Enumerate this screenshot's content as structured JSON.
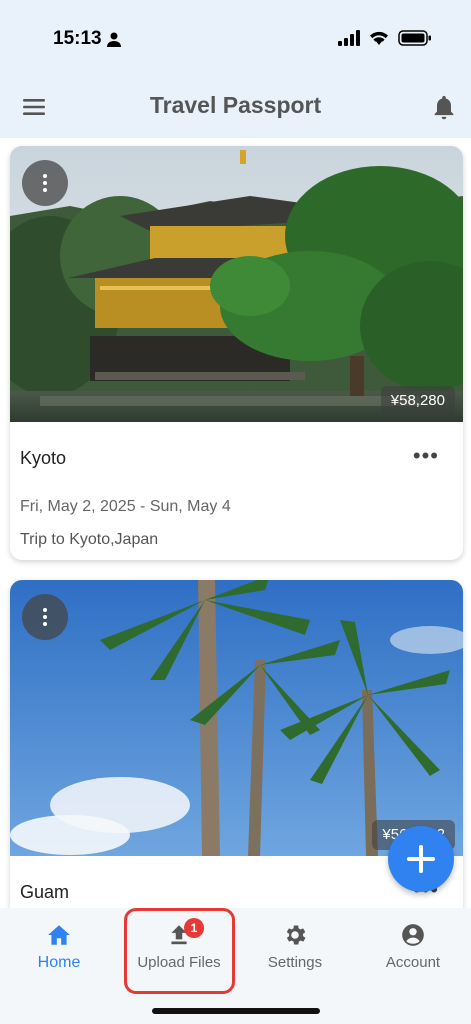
{
  "status_bar": {
    "time": "15:13"
  },
  "app_bar": {
    "title": "Travel Passport"
  },
  "trips": [
    {
      "title": "Kyoto",
      "price": "¥58,280",
      "dates": "Fri, May 2, 2025 - Sun, May 4",
      "description": "Trip to Kyoto,Japan"
    },
    {
      "title": "Guam",
      "price": "¥560,542",
      "dates": "",
      "description": ""
    }
  ],
  "bottom_nav": {
    "items": [
      {
        "label": "Home",
        "icon": "home-icon"
      },
      {
        "label": "Upload Files",
        "icon": "upload-icon",
        "badge": "1"
      },
      {
        "label": "Settings",
        "icon": "gear-icon"
      },
      {
        "label": "Account",
        "icon": "account-circle-icon"
      }
    ]
  },
  "colors": {
    "accent": "#2f82f0",
    "app_bar_bg": "#e9f2fb",
    "badge": "#e53935",
    "highlight": "#e53935"
  }
}
